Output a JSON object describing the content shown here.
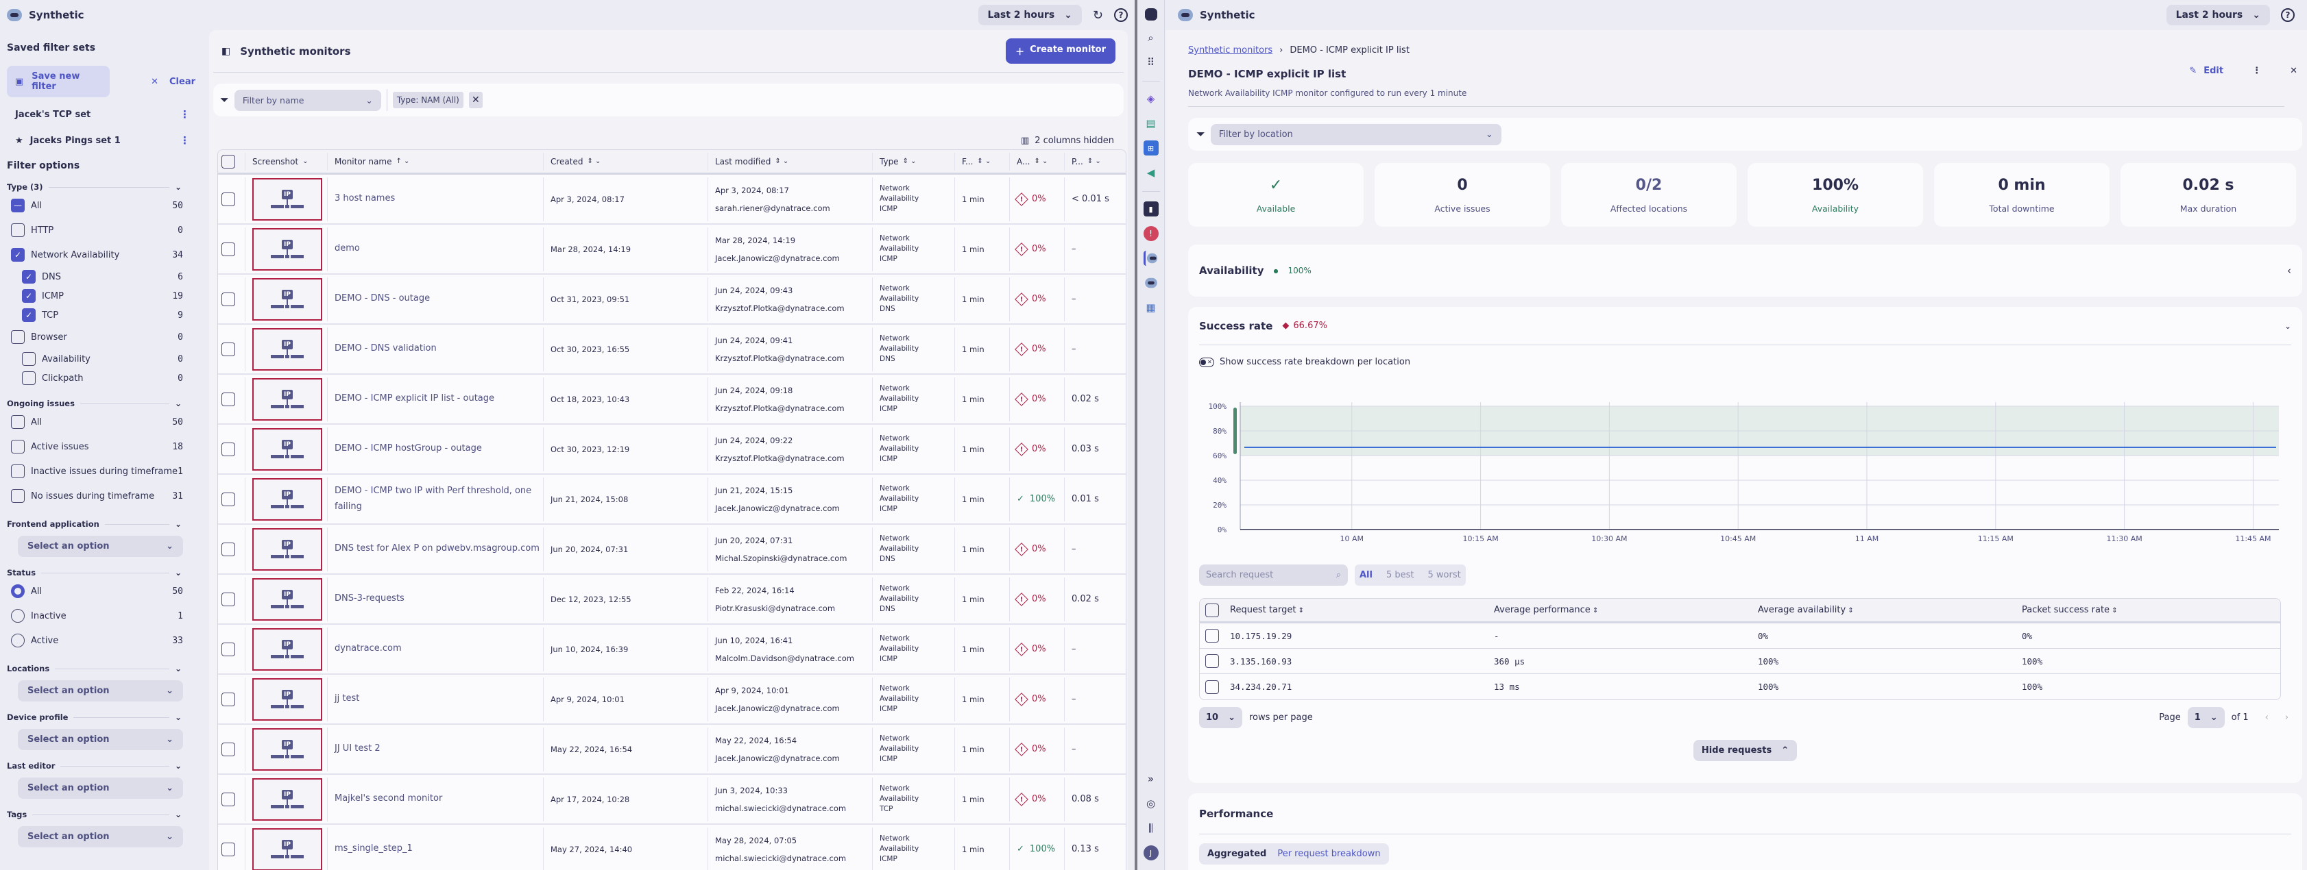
{
  "left_app": {
    "title": "Synthetic",
    "timeframe": "Last 2 hours",
    "sidebar": {
      "saved_filter_sets_title": "Saved filter sets",
      "save_new_filter": "Save new filter",
      "clear": "Clear",
      "saved_sets": [
        {
          "label": "Jacek's TCP set",
          "starred": false
        },
        {
          "label": "Jaceks Pings set 1",
          "starred": true
        }
      ],
      "filter_options_title": "Filter options",
      "type_group": {
        "title": "Type (3)",
        "options": [
          {
            "label": "All",
            "count": "50",
            "state": "indeterminate",
            "level": 0
          },
          {
            "label": "HTTP",
            "count": "0",
            "state": "off",
            "level": 0
          },
          {
            "label": "Network Availability",
            "count": "34",
            "state": "on",
            "level": 0
          },
          {
            "label": "DNS",
            "count": "6",
            "state": "on",
            "level": 1
          },
          {
            "label": "ICMP",
            "count": "19",
            "state": "on",
            "level": 1
          },
          {
            "label": "TCP",
            "count": "9",
            "state": "on",
            "level": 1
          },
          {
            "label": "Browser",
            "count": "0",
            "state": "off",
            "level": 0
          },
          {
            "label": "Availability",
            "count": "0",
            "state": "off",
            "level": 1
          },
          {
            "label": "Clickpath",
            "count": "0",
            "state": "off",
            "level": 1
          }
        ]
      },
      "ongoing_issues": {
        "title": "Ongoing issues",
        "options": [
          {
            "label": "All",
            "count": "50"
          },
          {
            "label": "Active issues",
            "count": "18"
          },
          {
            "label": "Inactive issues during timeframe",
            "count": "1"
          },
          {
            "label": "No issues during timeframe",
            "count": "31"
          }
        ]
      },
      "frontend_application": {
        "title": "Frontend application",
        "placeholder": "Select an option"
      },
      "status": {
        "title": "Status",
        "options": [
          {
            "label": "All",
            "count": "50",
            "selected": true
          },
          {
            "label": "Inactive",
            "count": "1",
            "selected": false
          },
          {
            "label": "Active",
            "count": "33",
            "selected": false
          }
        ]
      },
      "locations": {
        "title": "Locations",
        "placeholder": "Select an option"
      },
      "device_profile": {
        "title": "Device profile",
        "placeholder": "Select an option"
      },
      "last_editor": {
        "title": "Last editor",
        "placeholder": "Select an option"
      },
      "tags": {
        "title": "Tags",
        "placeholder": "Select an option"
      }
    },
    "main": {
      "title": "Synthetic monitors",
      "create_monitor": "Create monitor",
      "filter_placeholder": "Filter by name",
      "chip_key": "Type:",
      "chip_value": "NAM (All)",
      "columns_hidden": "2 columns hidden",
      "columns": [
        "Screenshot",
        "Monitor name",
        "Created",
        "Last modified",
        "Type",
        "F...",
        "A...",
        "P..."
      ],
      "rows": [
        {
          "name": "3 host names",
          "created": "Apr 3, 2024, 08:17",
          "modified": "Apr 3, 2024, 08:17",
          "editor": "sarah.riener@dynatrace.com",
          "type": [
            "Network",
            "Availability",
            "ICMP"
          ],
          "freq": "1 min",
          "avail": "0%",
          "ok": false,
          "perf": "< 0.01 s"
        },
        {
          "name": "demo",
          "created": "Mar 28, 2024, 14:19",
          "modified": "Mar 28, 2024, 14:19",
          "editor": "Jacek.Janowicz@dynatrace.com",
          "type": [
            "Network",
            "Availability",
            "ICMP"
          ],
          "freq": "1 min",
          "avail": "0%",
          "ok": false,
          "perf": "–"
        },
        {
          "name": "DEMO - DNS - outage",
          "created": "Oct 31, 2023, 09:51",
          "modified": "Jun 24, 2024, 09:43",
          "editor": "Krzysztof.Plotka@dynatrace.com",
          "type": [
            "Network",
            "Availability",
            "DNS"
          ],
          "freq": "1 min",
          "avail": "0%",
          "ok": false,
          "perf": "–"
        },
        {
          "name": "DEMO - DNS validation",
          "created": "Oct 30, 2023, 16:55",
          "modified": "Jun 24, 2024, 09:41",
          "editor": "Krzysztof.Plotka@dynatrace.com",
          "type": [
            "Network",
            "Availability",
            "DNS"
          ],
          "freq": "1 min",
          "avail": "0%",
          "ok": false,
          "perf": "–"
        },
        {
          "name": "DEMO - ICMP explicit IP list - outage",
          "created": "Oct 18, 2023, 10:43",
          "modified": "Jun 24, 2024, 09:18",
          "editor": "Krzysztof.Plotka@dynatrace.com",
          "type": [
            "Network",
            "Availability",
            "ICMP"
          ],
          "freq": "1 min",
          "avail": "0%",
          "ok": false,
          "perf": "0.02 s"
        },
        {
          "name": "DEMO - ICMP hostGroup - outage",
          "created": "Oct 30, 2023, 12:19",
          "modified": "Jun 24, 2024, 09:22",
          "editor": "Krzysztof.Plotka@dynatrace.com",
          "type": [
            "Network",
            "Availability",
            "ICMP"
          ],
          "freq": "1 min",
          "avail": "0%",
          "ok": false,
          "perf": "0.03 s"
        },
        {
          "name": "DEMO - ICMP two IP with Perf threshold, one failing",
          "created": "Jun 21, 2024, 15:08",
          "modified": "Jun 21, 2024, 15:15",
          "editor": "Jacek.Janowicz@dynatrace.com",
          "type": [
            "Network",
            "Availability",
            "ICMP"
          ],
          "freq": "1 min",
          "avail": "100%",
          "ok": true,
          "perf": "0.01 s"
        },
        {
          "name": "DNS test for Alex P on pdwebv.msagroup.com",
          "created": "Jun 20, 2024, 07:31",
          "modified": "Jun 20, 2024, 07:31",
          "editor": "Michal.Szopinski@dynatrace.com",
          "type": [
            "Network",
            "Availability",
            "DNS"
          ],
          "freq": "1 min",
          "avail": "0%",
          "ok": false,
          "perf": "–"
        },
        {
          "name": "DNS-3-requests",
          "created": "Dec 12, 2023, 12:55",
          "modified": "Feb 22, 2024, 16:14",
          "editor": "Piotr.Krasuski@dynatrace.com",
          "type": [
            "Network",
            "Availability",
            "DNS"
          ],
          "freq": "1 min",
          "avail": "0%",
          "ok": false,
          "perf": "0.02 s"
        },
        {
          "name": "dynatrace.com",
          "created": "Jun 10, 2024, 16:39",
          "modified": "Jun 10, 2024, 16:41",
          "editor": "Malcolm.Davidson@dynatrace.com",
          "type": [
            "Network",
            "Availability",
            "ICMP"
          ],
          "freq": "1 min",
          "avail": "0%",
          "ok": false,
          "perf": "–"
        },
        {
          "name": "jj test",
          "created": "Apr 9, 2024, 10:01",
          "modified": "Apr 9, 2024, 10:01",
          "editor": "Jacek.Janowicz@dynatrace.com",
          "type": [
            "Network",
            "Availability",
            "ICMP"
          ],
          "freq": "1 min",
          "avail": "0%",
          "ok": false,
          "perf": "–"
        },
        {
          "name": "JJ UI test 2",
          "created": "May 22, 2024, 16:54",
          "modified": "May 22, 2024, 16:54",
          "editor": "Jacek.Janowicz@dynatrace.com",
          "type": [
            "Network",
            "Availability",
            "ICMP"
          ],
          "freq": "1 min",
          "avail": "0%",
          "ok": false,
          "perf": "–"
        },
        {
          "name": "Majkel's second monitor",
          "created": "Apr 17, 2024, 10:28",
          "modified": "Jun 3, 2024, 10:33",
          "editor": "michal.swiecicki@dynatrace.com",
          "type": [
            "Network",
            "Availability",
            "TCP"
          ],
          "freq": "1 min",
          "avail": "0%",
          "ok": false,
          "perf": "0.08 s"
        },
        {
          "name": "ms_single_step_1",
          "created": "May 27, 2024, 14:40",
          "modified": "May 28, 2024, 07:05",
          "editor": "michal.swiecicki@dynatrace.com",
          "type": [
            "Network",
            "Availability",
            "ICMP"
          ],
          "freq": "1 min",
          "avail": "100%",
          "ok": true,
          "perf": "0.13 s"
        }
      ]
    }
  },
  "right_app": {
    "title": "Synthetic",
    "timeframe": "Last 2 hours",
    "breadcrumb_link": "Synthetic monitors",
    "breadcrumb_current": "DEMO - ICMP explicit IP list",
    "monitor_title": "DEMO - ICMP explicit IP list",
    "monitor_subtitle": "Network Availability ICMP monitor configured to run every 1 minute",
    "edit": "Edit",
    "location_filter_placeholder": "Filter by location",
    "kpis": [
      {
        "value": "✓",
        "label": "Available",
        "tone": "green"
      },
      {
        "value": "0",
        "label": "Active issues",
        "tone": "default"
      },
      {
        "value": "0/2",
        "label": "Affected locations",
        "tone": "mixed"
      },
      {
        "value": "100%",
        "label": "Availability",
        "tone": "green-label"
      },
      {
        "value": "0 min",
        "label": "Total downtime",
        "tone": "default"
      },
      {
        "value": "0.02 s",
        "label": "Max duration",
        "tone": "default"
      }
    ],
    "availability": {
      "title": "Availability",
      "value": "100%"
    },
    "success_rate": {
      "title": "Success rate",
      "value": "66.67%",
      "toggle_label": "Show success rate breakdown per location"
    },
    "requests": {
      "search_placeholder": "Search request",
      "segments": [
        "All",
        "5 best",
        "5 worst"
      ],
      "active_segment": "All",
      "columns": [
        "Request target",
        "Average performance",
        "Average availability",
        "Packet success rate"
      ],
      "rows": [
        {
          "target": "10.175.19.29",
          "perf": "-",
          "avail": "0%",
          "packet": "0%"
        },
        {
          "target": "3.135.160.93",
          "perf": "360 µs",
          "avail": "100%",
          "packet": "100%"
        },
        {
          "target": "34.234.20.71",
          "perf": "13 ms",
          "avail": "100%",
          "packet": "100%"
        }
      ],
      "rows_per_page_value": "10",
      "rows_per_page_label": "rows per page",
      "page_label": "Page",
      "page_value": "1",
      "page_of": "of 1",
      "hide_requests": "Hide requests"
    },
    "performance": {
      "title": "Performance",
      "segments": [
        "Aggregated",
        "Per request breakdown"
      ]
    }
  },
  "chart_data": {
    "type": "line",
    "title": "Success rate",
    "x": [
      "09:47",
      "10:00",
      "10:15",
      "10:30",
      "10:45",
      "11:00",
      "11:15",
      "11:30",
      "11:45"
    ],
    "xticks": [
      "10 AM",
      "10:15 AM",
      "10:30 AM",
      "10:45 AM",
      "11 AM",
      "11:15 AM",
      "11:30 AM",
      "11:45 AM"
    ],
    "series": [
      {
        "name": "Success rate",
        "values": [
          66.67,
          66.67,
          66.67,
          66.67,
          66.67,
          66.67,
          66.67,
          66.67,
          66.67
        ],
        "color": "#3a6fd8"
      }
    ],
    "yticks": [
      "0%",
      "20%",
      "40%",
      "60%",
      "80%",
      "100%"
    ],
    "ylim": [
      0,
      100
    ],
    "threshold_band": [
      60,
      100
    ],
    "grid": true,
    "xlabel": "",
    "ylabel": ""
  },
  "colors": {
    "accent": "#4e55c6",
    "error": "#b01f44",
    "success": "#2b7a5c"
  }
}
